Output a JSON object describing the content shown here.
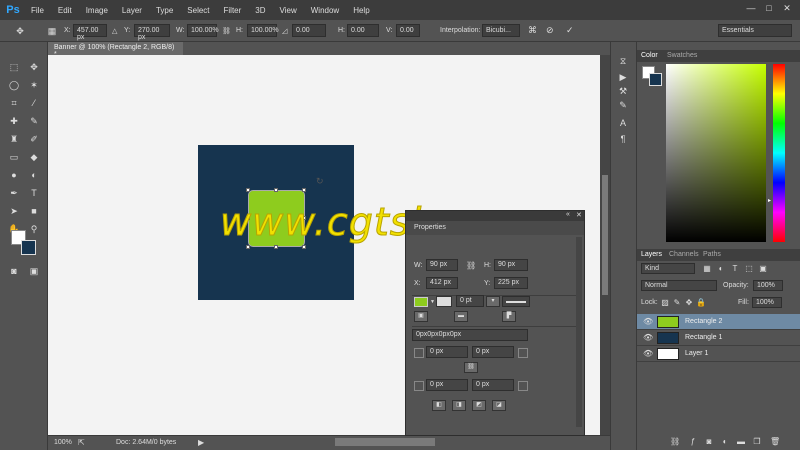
{
  "app": {
    "logo": "Ps"
  },
  "menu": [
    "File",
    "Edit",
    "Image",
    "Layer",
    "Type",
    "Select",
    "Filter",
    "3D",
    "View",
    "Window",
    "Help"
  ],
  "window_controls": [
    "—",
    "□",
    "✕"
  ],
  "options": {
    "x_label": "X:",
    "x_value": "457.00 px",
    "y_label": "Y:",
    "y_value": "270.00 px",
    "w_label": "W:",
    "w_value": "100.00%",
    "h_label": "H:",
    "h_value": "100.00%",
    "rot_value": "0.00",
    "hskew_label": "H:",
    "hskew_value": "0.00",
    "vskew_label": "V:",
    "vskew_value": "0.00",
    "interp_label": "Interpolation:",
    "interp_value": "Bicubi...",
    "workspace": "Essentials"
  },
  "doc_tab": "Banner @ 100% (Rectangle 2, RGB/8) *",
  "watermark": "www.cgtsj.com",
  "status": {
    "zoom": "100%",
    "doc": "Doc: 2.64M/0 bytes"
  },
  "properties": {
    "tab_label": "Properties",
    "w_label": "W:",
    "w_value": "90 px",
    "h_label": "H:",
    "h_value": "90 px",
    "x_label": "X:",
    "x_value": "412 px",
    "y_label": "Y:",
    "y_value": "225 px",
    "stroke_value": "0 pt",
    "radius_all": "0px0px0px0px",
    "tl": "0 px",
    "tr": "0 px",
    "bl": "0 px",
    "br": "0 px",
    "fill_color": "#8ecc1e"
  },
  "color_panel": {
    "tabs": [
      "Color",
      "Swatches"
    ],
    "fg": "#ffffff",
    "bg": "#16344f"
  },
  "layers_panel": {
    "tabs": [
      "Layers",
      "Channels",
      "Paths"
    ],
    "kind": "Kind",
    "blend": "Normal",
    "opacity_label": "Opacity:",
    "opacity_value": "100%",
    "lock_label": "Lock:",
    "fill_label": "Fill:",
    "fill_value": "100%",
    "layers": [
      "Rectangle 2",
      "Rectangle 1",
      "Layer 1"
    ]
  }
}
